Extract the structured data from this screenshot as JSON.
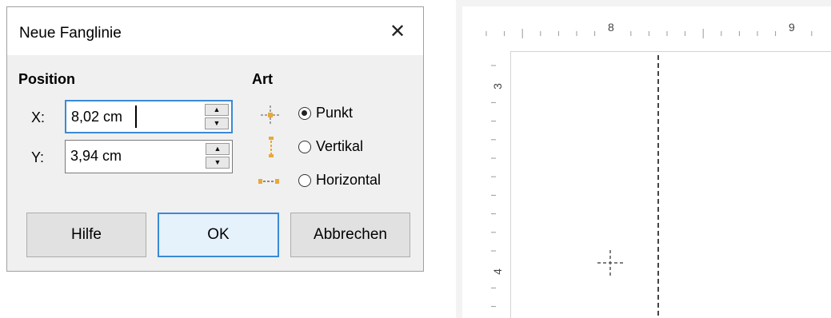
{
  "dialog": {
    "title": "Neue Fanglinie",
    "position_heading": "Position",
    "x_label": "X:",
    "x_value": "8,02 cm",
    "y_label": "Y:",
    "y_value": "3,94 cm",
    "art_heading": "Art",
    "options": [
      {
        "label": "Punkt",
        "checked": true
      },
      {
        "label": "Vertikal",
        "checked": false
      },
      {
        "label": "Horizontal",
        "checked": false
      }
    ],
    "buttons": {
      "help": "Hilfe",
      "ok": "OK",
      "cancel": "Abbrechen"
    }
  },
  "rulers": {
    "horizontal_labels": [
      "8",
      "9"
    ],
    "vertical_labels": [
      "3",
      "4"
    ]
  },
  "colors": {
    "accent": "#3a8ad6",
    "marker": "#e8a838"
  }
}
